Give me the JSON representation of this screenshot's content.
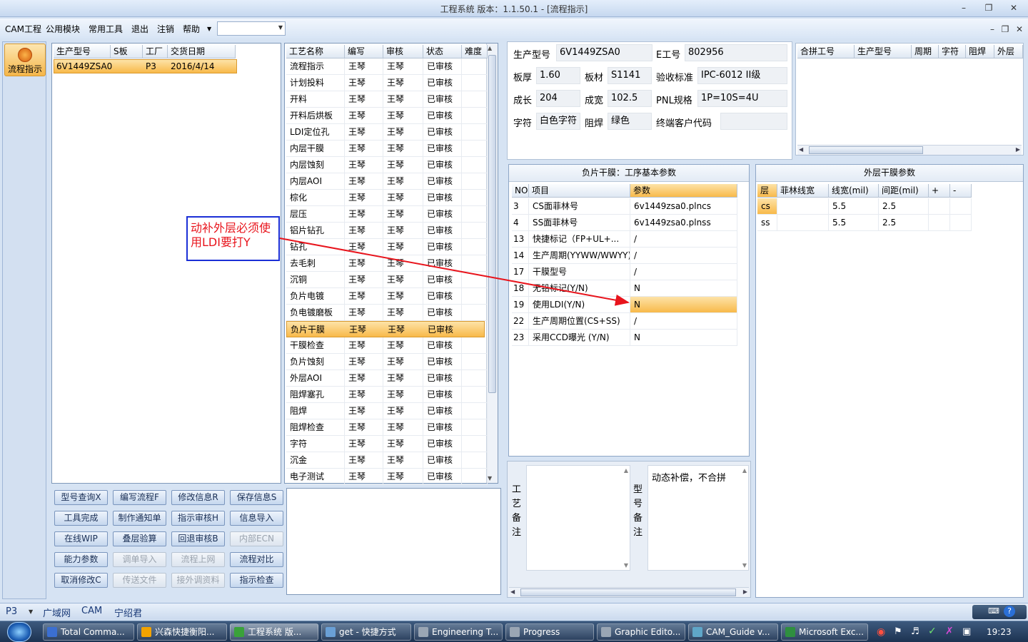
{
  "window": {
    "title": "工程系统   版本：1.1.50.1 - [流程指示]"
  },
  "menu": [
    "CAM工程",
    "公用模块",
    "常用工具",
    "退出",
    "注销",
    "帮助"
  ],
  "left_nav": {
    "label": "流程指示"
  },
  "orders": {
    "headers": [
      "生产型号",
      "S板",
      "工厂",
      "交货日期"
    ],
    "rows": [
      [
        "6V1449ZSA0",
        "",
        "P3",
        "2016/4/14"
      ]
    ]
  },
  "process": {
    "headers": [
      "工艺名称",
      "编写",
      "审核",
      "状态",
      "难度"
    ],
    "rows": [
      [
        "流程指示",
        "王琴",
        "王琴",
        "已审核"
      ],
      [
        "计划投料",
        "王琴",
        "王琴",
        "已审核"
      ],
      [
        "开料",
        "王琴",
        "王琴",
        "已审核"
      ],
      [
        "开料后烘板",
        "王琴",
        "王琴",
        "已审核"
      ],
      [
        "LDI定位孔",
        "王琴",
        "王琴",
        "已审核"
      ],
      [
        "内层干膜",
        "王琴",
        "王琴",
        "已审核"
      ],
      [
        "内层蚀刻",
        "王琴",
        "王琴",
        "已审核"
      ],
      [
        "内层AOI",
        "王琴",
        "王琴",
        "已审核"
      ],
      [
        "棕化",
        "王琴",
        "王琴",
        "已审核"
      ],
      [
        "层压",
        "王琴",
        "王琴",
        "已审核"
      ],
      [
        "铝片钻孔",
        "王琴",
        "王琴",
        "已审核"
      ],
      [
        "钻孔",
        "王琴",
        "王琴",
        "已审核"
      ],
      [
        "去毛刺",
        "王琴",
        "王琴",
        "已审核"
      ],
      [
        "沉铜",
        "王琴",
        "王琴",
        "已审核"
      ],
      [
        "负片电镀",
        "王琴",
        "王琴",
        "已审核"
      ],
      [
        "负电镀磨板",
        "王琴",
        "王琴",
        "已审核"
      ],
      [
        "负片干膜",
        "王琴",
        "王琴",
        "已审核"
      ],
      [
        "干膜检查",
        "王琴",
        "王琴",
        "已审核"
      ],
      [
        "负片蚀刻",
        "王琴",
        "王琴",
        "已审核"
      ],
      [
        "外层AOI",
        "王琴",
        "王琴",
        "已审核"
      ],
      [
        "阻焊塞孔",
        "王琴",
        "王琴",
        "已审核"
      ],
      [
        "阻焊",
        "王琴",
        "王琴",
        "已审核"
      ],
      [
        "阻焊检查",
        "王琴",
        "王琴",
        "已审核"
      ],
      [
        "字符",
        "王琴",
        "王琴",
        "已审核"
      ],
      [
        "沉金",
        "王琴",
        "王琴",
        "已审核"
      ],
      [
        "电子测试",
        "王琴",
        "王琴",
        "已审核"
      ]
    ]
  },
  "buttons": [
    [
      "型号查询X",
      "编写流程F",
      "修改信息R",
      "保存信息S"
    ],
    [
      "工具完成",
      "制作通知单",
      "指示审核H",
      "信息导入"
    ],
    [
      "在线WIP",
      "叠层验算",
      "回退审核B",
      "内部ECN"
    ],
    [
      "能力参数",
      "调单导入",
      "流程上网",
      "流程对比"
    ],
    [
      "取消修改C",
      "传送文件",
      "接外调资料",
      "指示检查"
    ]
  ],
  "annotation": "动补外层必须使用LDI要打Y",
  "info": {
    "model_label": "生产型号",
    "model": "6V1449ZSA0",
    "eno_label": "E工号",
    "eno": "802956",
    "thick_label": "板厚",
    "thick": "1.60",
    "mat_label": "板材",
    "mat": "S1141",
    "std_label": "验收标准",
    "std": "IPC-6012 II级",
    "len_label": "成长",
    "len": "204",
    "wid_label": "成宽",
    "wid": "102.5",
    "pnl_label": "PNL规格",
    "pnl": "1P=10S=4U",
    "char_label": "字符",
    "char": "白色字符",
    "mask_label": "阻焊",
    "mask": "绿色",
    "cust_label": "终端客户代码",
    "cust": ""
  },
  "merge_table": {
    "headers": [
      "合拼工号",
      "生产型号",
      "周期",
      "字符",
      "阻焊",
      "外层"
    ]
  },
  "params": {
    "title": "负片干膜：工序基本参数",
    "headers": [
      "NO",
      "项目",
      "参数"
    ],
    "rows": [
      [
        "3",
        "CS面菲林号",
        "6v1449zsa0.plncs"
      ],
      [
        "4",
        "SS面菲林号",
        "6v1449zsa0.plnss"
      ],
      [
        "13",
        "快捷标记（FP+UL+...",
        "/"
      ],
      [
        "14",
        "生产周期(YYWW/WWYY)",
        "/"
      ],
      [
        "17",
        "干膜型号",
        "/"
      ],
      [
        "18",
        "无铅标记(Y/N)",
        "N"
      ],
      [
        "19",
        "使用LDI(Y/N)",
        "N"
      ],
      [
        "22",
        "生产周期位置(CS+SS)",
        "/"
      ],
      [
        "23",
        "采用CCD曝光 (Y/N)",
        "N"
      ]
    ]
  },
  "outer": {
    "title": "外层干膜参数",
    "headers": [
      "层",
      "菲林线宽",
      "线宽(mil)",
      "间距(mil)",
      "+",
      "-"
    ],
    "rows": [
      [
        "cs",
        "",
        "5.5",
        "2.5",
        "",
        ""
      ],
      [
        "ss",
        "",
        "5.5",
        "2.5",
        "",
        ""
      ]
    ]
  },
  "notes": {
    "process_label": "工艺备注",
    "model_label": "型号备注",
    "model_text": "动态补偿，不合拼"
  },
  "status": {
    "factory": "P3",
    "tabs": [
      "广域网",
      "CAM",
      "宁绍君"
    ]
  },
  "taskbar": {
    "items": [
      "Total Comma...",
      "兴森快捷衡阳...",
      "工程系统  版...",
      "get - 快捷方式",
      "Engineering T...",
      "Progress",
      "Graphic Edito...",
      "CAM_Guide v...",
      "Microsoft Exc..."
    ],
    "time": "19:23"
  },
  "colors": {
    "selection": "#f8b94a",
    "annotation": "#e8141c",
    "annotation_box": "#1b2fd6"
  }
}
